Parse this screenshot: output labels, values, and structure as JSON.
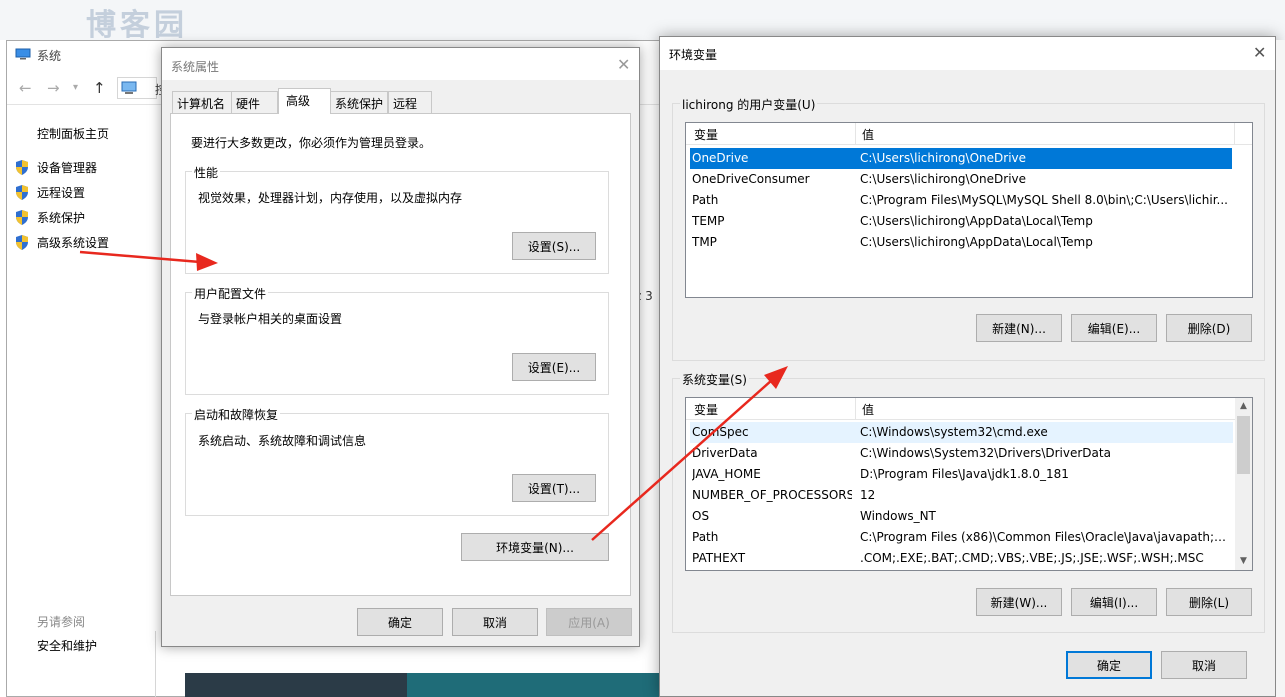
{
  "logo": {
    "text": "博客园"
  },
  "system_window": {
    "title": "系统",
    "address_partial": "控",
    "control_panel_home": "控制面板主页",
    "items": [
      {
        "label": "设备管理器"
      },
      {
        "label": "远程设置"
      },
      {
        "label": "系统保护"
      },
      {
        "label": "高级系统设置"
      }
    ],
    "see_also": "另请参阅",
    "security_maintenance": "安全和维护",
    "clipped_text": "z 3"
  },
  "system_properties": {
    "title": "系统属性",
    "tabs": [
      {
        "label": "计算机名"
      },
      {
        "label": "硬件"
      },
      {
        "label": "高级"
      },
      {
        "label": "系统保护"
      },
      {
        "label": "远程"
      }
    ],
    "active_tab": "高级",
    "admin_notice": "要进行大多数更改，你必须作为管理员登录。",
    "performance": {
      "label": "性能",
      "description": "视觉效果，处理器计划，内存使用，以及虚拟内存",
      "button": "设置(S)..."
    },
    "user_profiles": {
      "label": "用户配置文件",
      "description": "与登录帐户相关的桌面设置",
      "button": "设置(E)..."
    },
    "startup_recovery": {
      "label": "启动和故障恢复",
      "description": "系统启动、系统故障和调试信息",
      "button": "设置(T)..."
    },
    "env_button": "环境变量(N)...",
    "ok": "确定",
    "cancel": "取消",
    "apply": "应用(A)"
  },
  "env_vars": {
    "title": "环境变量",
    "user_group_label": "lichirong 的用户变量(U)",
    "columns": {
      "name": "变量",
      "value": "值"
    },
    "user_vars": [
      {
        "name": "OneDrive",
        "value": "C:\\Users\\lichirong\\OneDrive"
      },
      {
        "name": "OneDriveConsumer",
        "value": "C:\\Users\\lichirong\\OneDrive"
      },
      {
        "name": "Path",
        "value": "C:\\Program Files\\MySQL\\MySQL Shell 8.0\\bin\\;C:\\Users\\lichir..."
      },
      {
        "name": "TEMP",
        "value": "C:\\Users\\lichirong\\AppData\\Local\\Temp"
      },
      {
        "name": "TMP",
        "value": "C:\\Users\\lichirong\\AppData\\Local\\Temp"
      }
    ],
    "user_buttons": {
      "new": "新建(N)...",
      "edit": "编辑(E)...",
      "delete": "删除(D)"
    },
    "system_group_label": "系统变量(S)",
    "system_vars": [
      {
        "name": "ComSpec",
        "value": "C:\\Windows\\system32\\cmd.exe"
      },
      {
        "name": "DriverData",
        "value": "C:\\Windows\\System32\\Drivers\\DriverData"
      },
      {
        "name": "JAVA_HOME",
        "value": "D:\\Program Files\\Java\\jdk1.8.0_181"
      },
      {
        "name": "NUMBER_OF_PROCESSORS",
        "value": "12"
      },
      {
        "name": "OS",
        "value": "Windows_NT"
      },
      {
        "name": "Path",
        "value": "C:\\Program Files (x86)\\Common Files\\Oracle\\Java\\javapath;C:..."
      },
      {
        "name": "PATHEXT",
        "value": ".COM;.EXE;.BAT;.CMD;.VBS;.VBE;.JS;.JSE;.WSF;.WSH;.MSC"
      }
    ],
    "system_buttons": {
      "new": "新建(W)...",
      "edit": "编辑(I)...",
      "delete": "删除(L)"
    },
    "ok": "确定",
    "cancel": "取消"
  },
  "colors": {
    "selection": "#0078d7",
    "arrow": "#e8281e",
    "dialog_bg": "#f0f0f0"
  }
}
